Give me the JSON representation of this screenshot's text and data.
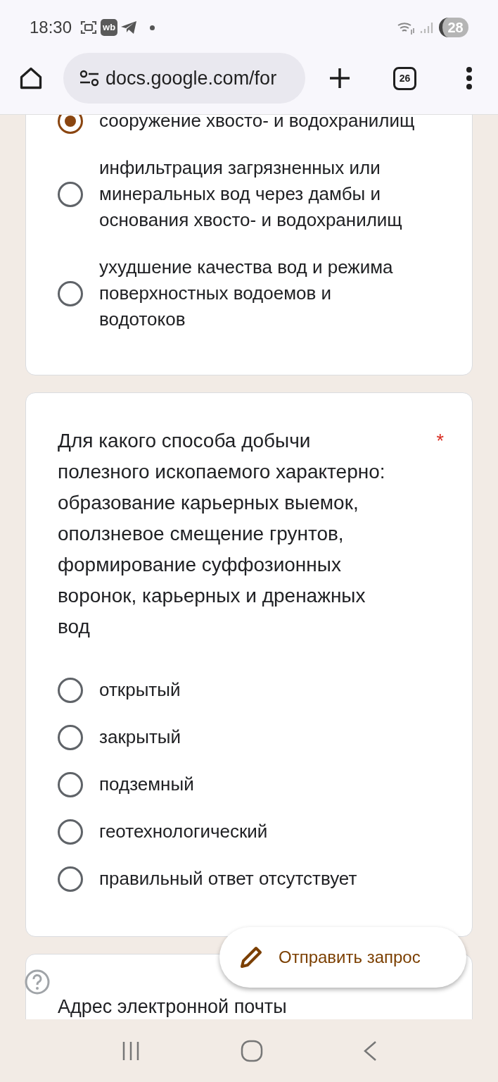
{
  "status_bar": {
    "time": "18:30",
    "app_badge": "wb",
    "battery": "28"
  },
  "browser": {
    "url": "docs.google.com/for",
    "tab_count": "26"
  },
  "cards": [
    {
      "options": [
        {
          "label": "сооружение хвосто- и водохранилищ",
          "selected": true
        },
        {
          "label": "инфильтрация загрязненных или минеральных вод через дамбы и основания хвосто- и водохранилищ",
          "selected": false
        },
        {
          "label": "ухудшение качества вод и режима поверхностных водоемов и водотоков",
          "selected": false
        }
      ]
    },
    {
      "title": "Для какого способа добычи полезного ископаемого характерно: образование карьерных выемок, оползневое смещение грунтов, формирование суффозионных воронок, карьерных и дренажных вод",
      "required": true,
      "required_mark": "*",
      "options": [
        {
          "label": "открытый",
          "selected": false
        },
        {
          "label": "закрытый",
          "selected": false
        },
        {
          "label": "подземный",
          "selected": false
        },
        {
          "label": "геотехнологический",
          "selected": false
        },
        {
          "label": "правильный ответ отсутствует",
          "selected": false
        }
      ]
    },
    {
      "title": "Адрес электронной почты"
    }
  ],
  "fab": {
    "label": "Отправить запрос"
  }
}
